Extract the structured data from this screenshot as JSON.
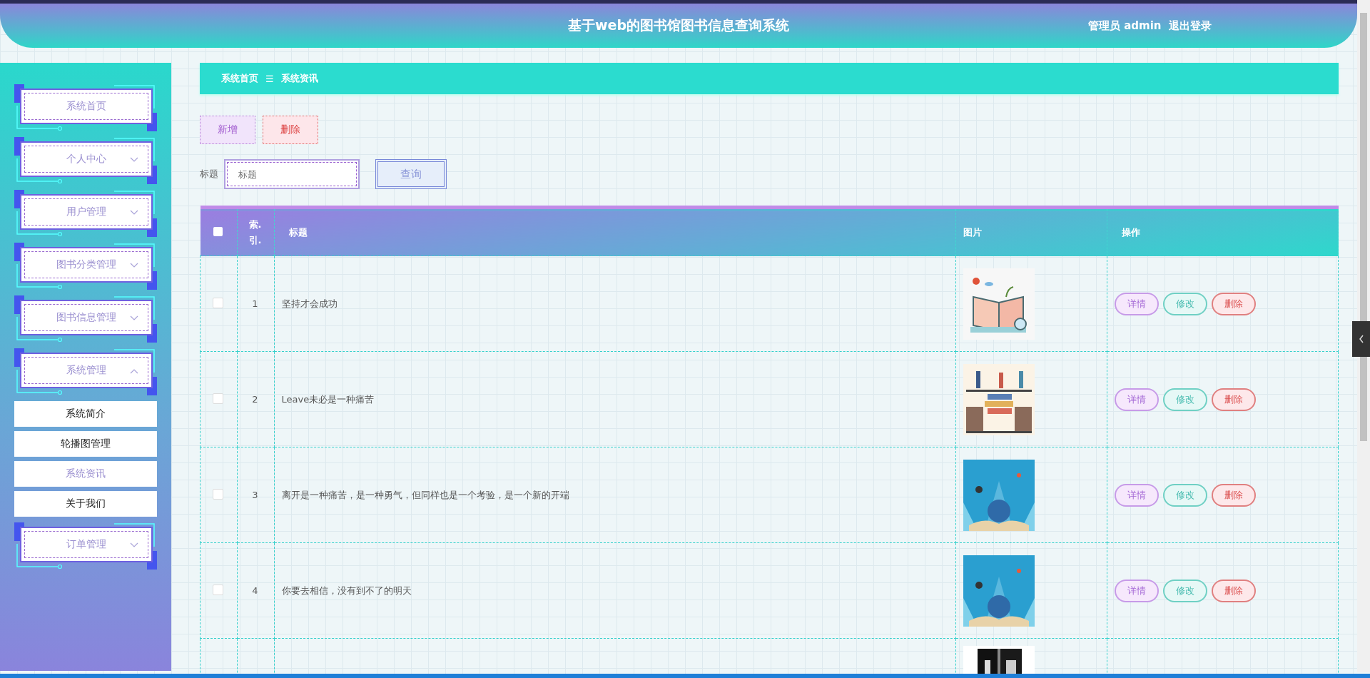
{
  "header": {
    "title": "基于web的图书馆图书信息查询系统",
    "user": "管理员 admin",
    "logout": "退出登录"
  },
  "sidebar": {
    "items": [
      {
        "label": "系统首页"
      },
      {
        "label": "个人中心",
        "expanded": false
      },
      {
        "label": "用户管理",
        "expanded": false
      },
      {
        "label": "图书分类管理",
        "expanded": false
      },
      {
        "label": "图书信息管理",
        "expanded": false
      },
      {
        "label": "系统管理",
        "expanded": true,
        "children": [
          {
            "label": "系统简介",
            "selected": false
          },
          {
            "label": "轮播图管理",
            "selected": false
          },
          {
            "label": "系统资讯",
            "selected": true
          },
          {
            "label": "关于我们",
            "selected": false
          }
        ]
      },
      {
        "label": "订单管理",
        "expanded": false
      }
    ]
  },
  "breadcrumb": {
    "items": [
      "系统首页",
      "系统资讯"
    ],
    "separator": "☰"
  },
  "toolbar": {
    "buttons": [
      {
        "label": "新增",
        "kind": "add"
      },
      {
        "label": "删除",
        "kind": "delete"
      }
    ]
  },
  "search": {
    "label": "标题",
    "placeholder": "标题",
    "button": "查询"
  },
  "table": {
    "columns": [
      "索. 引.",
      "标题",
      "图片",
      "操作"
    ],
    "select_all_checked": false,
    "rows": [
      {
        "checked": false,
        "index": "1",
        "title": "坚持才会成功",
        "image": {
          "kind": "picture"
        },
        "actions": [
          {
            "label": "详情",
            "kind": "detail"
          },
          {
            "label": "修改",
            "kind": "edit"
          },
          {
            "label": "删除",
            "kind": "delete"
          }
        ]
      },
      {
        "checked": false,
        "index": "2",
        "title": "Leave未必是一种痛苦",
        "image": {
          "kind": "picture"
        },
        "actions": [
          {
            "label": "详情",
            "kind": "detail"
          },
          {
            "label": "修改",
            "kind": "edit"
          },
          {
            "label": "删除",
            "kind": "delete"
          }
        ]
      },
      {
        "checked": false,
        "index": "3",
        "title": "离开是一种痛苦，是一种勇气，但同样也是一个考验，是一个新的开端",
        "image": {
          "kind": "picture"
        },
        "actions": [
          {
            "label": "详情",
            "kind": "detail"
          },
          {
            "label": "修改",
            "kind": "edit"
          },
          {
            "label": "删除",
            "kind": "delete"
          }
        ]
      },
      {
        "checked": false,
        "index": "4",
        "title": "你要去相信，没有到不了的明天",
        "image": {
          "kind": "picture"
        },
        "actions": [
          {
            "label": "详情",
            "kind": "detail"
          },
          {
            "label": "修改",
            "kind": "edit"
          },
          {
            "label": "删除",
            "kind": "delete"
          }
        ]
      },
      {
        "image": {
          "kind": "picture"
        }
      }
    ]
  }
}
